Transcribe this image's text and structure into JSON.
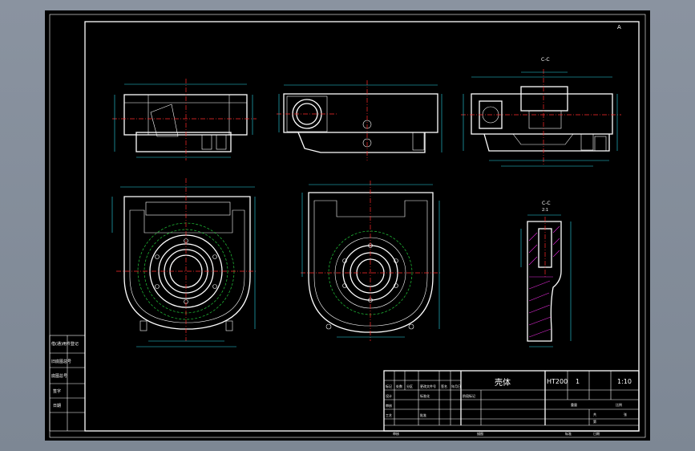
{
  "drawing": {
    "colors": {
      "sheet": "#000000",
      "outline": "#ffffff",
      "dimension": "#27d7e8",
      "center": "#ff2a2a",
      "hidden": "#22c93a",
      "background": "#8a93a0"
    },
    "section_label": "C-C",
    "section_label_2": "C-C",
    "section_scale": "2:1",
    "top_mark": "A",
    "title_block": {
      "part_name": "壳体",
      "material": "HT200",
      "quantity": "1",
      "scale": "1:10",
      "row_labels": [
        "标记",
        "处数",
        "分区",
        "更改文件号",
        "签名",
        "年月日"
      ],
      "design": "设计",
      "standard": "标准化",
      "process": "工艺",
      "check": "审核",
      "approve": "批准",
      "stage_mark": "阶段标记",
      "weight": "重量",
      "ratio": "比例",
      "sheet_total": "共",
      "sheet_of": "第",
      "page": "张",
      "bottom": [
        "审核",
        "描图",
        "标准",
        "日期"
      ]
    },
    "left_strip": [
      "借(通)用件登记",
      "旧底图总号",
      "底图总号",
      "签字",
      "日期"
    ]
  }
}
